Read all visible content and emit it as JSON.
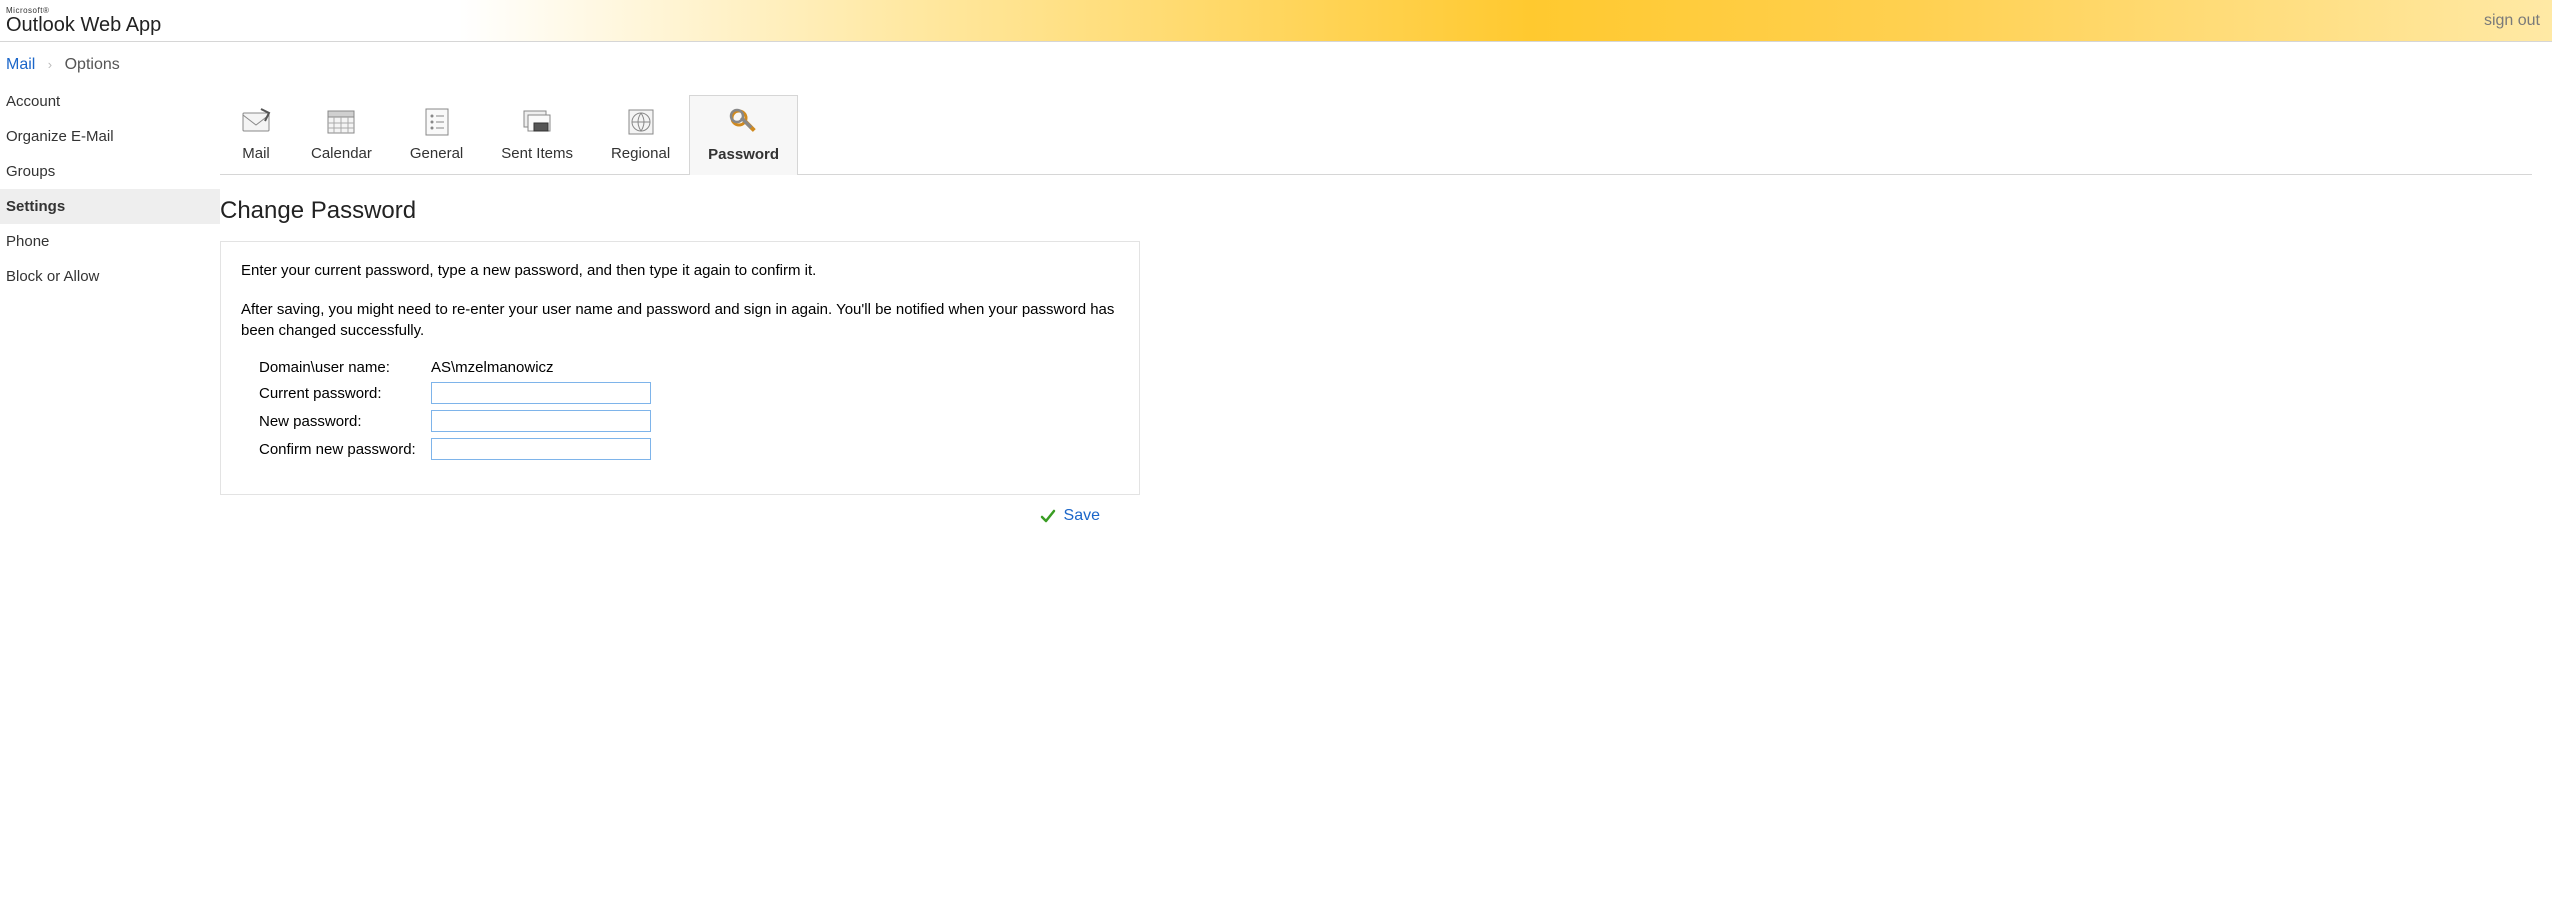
{
  "header": {
    "ms": "Microsoft®",
    "logo_outlook": "Outlook",
    "logo_rest": " Web App",
    "signout": "sign out"
  },
  "breadcrumb": {
    "root": "Mail",
    "current": "Options"
  },
  "sidebar": {
    "items": [
      {
        "label": "Account",
        "active": false
      },
      {
        "label": "Organize E-Mail",
        "active": false
      },
      {
        "label": "Groups",
        "active": false
      },
      {
        "label": "Settings",
        "active": true
      },
      {
        "label": "Phone",
        "active": false
      },
      {
        "label": "Block or Allow",
        "active": false
      }
    ]
  },
  "tabs": [
    {
      "label": "Mail",
      "icon": "mail-icon",
      "active": false
    },
    {
      "label": "Calendar",
      "icon": "calendar-icon",
      "active": false
    },
    {
      "label": "General",
      "icon": "general-icon",
      "active": false
    },
    {
      "label": "Sent Items",
      "icon": "sent-items-icon",
      "active": false
    },
    {
      "label": "Regional",
      "icon": "regional-icon",
      "active": false
    },
    {
      "label": "Password",
      "icon": "password-icon",
      "active": true
    }
  ],
  "page": {
    "title": "Change Password",
    "intro1": "Enter your current password, type a new password, and then type it again to confirm it.",
    "intro2": "After saving, you might need to re-enter your user name and password and sign in again. You'll be notified when your password has been changed successfully.",
    "form": {
      "domain_label": "Domain\\user name:",
      "domain_value": "AS\\mzelmanowicz",
      "current_label": "Current password:",
      "current_value": "",
      "new_label": "New password:",
      "new_value": "",
      "confirm_label": "Confirm new password:",
      "confirm_value": ""
    },
    "save": "Save"
  }
}
